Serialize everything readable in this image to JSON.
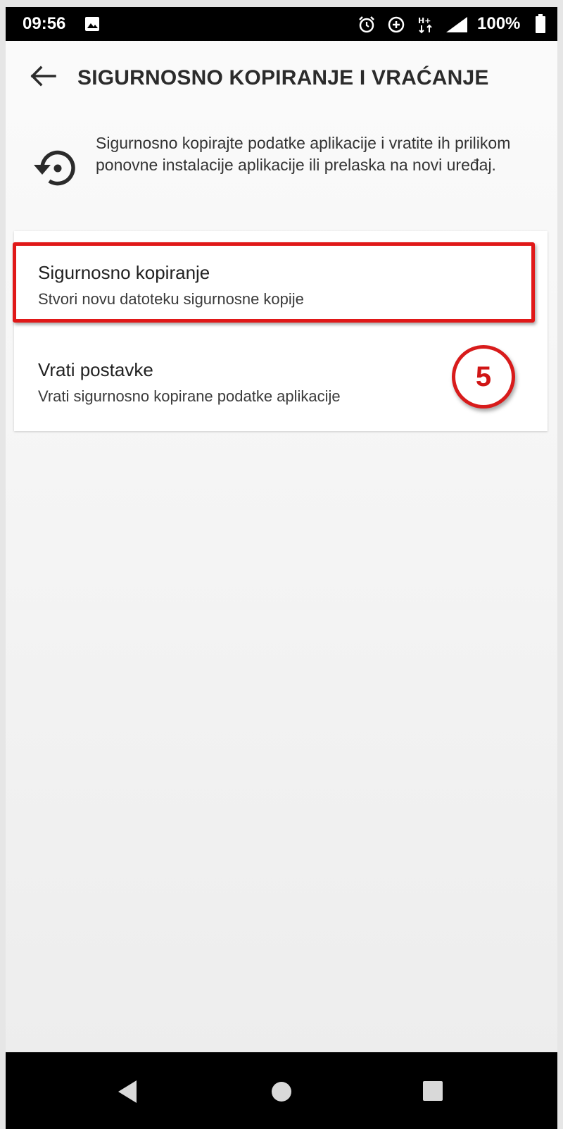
{
  "status_bar": {
    "time": "09:56",
    "battery": "100%",
    "icons": [
      "image-icon",
      "alarm-icon",
      "data-saver-icon",
      "data-transfer-icon",
      "signal-icon",
      "battery-icon"
    ]
  },
  "header": {
    "title": "SIGURNOSNO KOPIRANJE I VRAĆANJE",
    "back_icon": "arrow-left-icon"
  },
  "description": {
    "icon": "backup-restore-icon",
    "text": "Sigurnosno kopirajte podatke aplikacije i vratite ih prilikom ponovne instalacije aplikacije ili prelaska na novi uređaj."
  },
  "items": [
    {
      "title": "Sigurnosno kopiranje",
      "subtitle": "Stvori novu datoteku sigurnosne kopije"
    },
    {
      "title": "Vrati postavke",
      "subtitle": "Vrati sigurnosno kopirane podatke aplikacije"
    }
  ],
  "annotation": {
    "step_number": "5",
    "color": "#e01818"
  },
  "nav_bar": {
    "icons": [
      "back-triangle-icon",
      "home-circle-icon",
      "recents-square-icon"
    ]
  }
}
